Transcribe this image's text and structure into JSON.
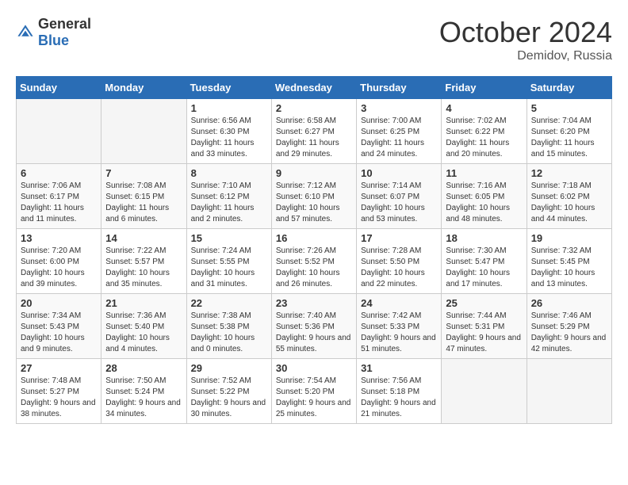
{
  "header": {
    "logo_general": "General",
    "logo_blue": "Blue",
    "month": "October 2024",
    "location": "Demidov, Russia"
  },
  "weekdays": [
    "Sunday",
    "Monday",
    "Tuesday",
    "Wednesday",
    "Thursday",
    "Friday",
    "Saturday"
  ],
  "weeks": [
    [
      {
        "day": "",
        "sunrise": "",
        "sunset": "",
        "daylight": ""
      },
      {
        "day": "",
        "sunrise": "",
        "sunset": "",
        "daylight": ""
      },
      {
        "day": "1",
        "sunrise": "Sunrise: 6:56 AM",
        "sunset": "Sunset: 6:30 PM",
        "daylight": "Daylight: 11 hours and 33 minutes."
      },
      {
        "day": "2",
        "sunrise": "Sunrise: 6:58 AM",
        "sunset": "Sunset: 6:27 PM",
        "daylight": "Daylight: 11 hours and 29 minutes."
      },
      {
        "day": "3",
        "sunrise": "Sunrise: 7:00 AM",
        "sunset": "Sunset: 6:25 PM",
        "daylight": "Daylight: 11 hours and 24 minutes."
      },
      {
        "day": "4",
        "sunrise": "Sunrise: 7:02 AM",
        "sunset": "Sunset: 6:22 PM",
        "daylight": "Daylight: 11 hours and 20 minutes."
      },
      {
        "day": "5",
        "sunrise": "Sunrise: 7:04 AM",
        "sunset": "Sunset: 6:20 PM",
        "daylight": "Daylight: 11 hours and 15 minutes."
      }
    ],
    [
      {
        "day": "6",
        "sunrise": "Sunrise: 7:06 AM",
        "sunset": "Sunset: 6:17 PM",
        "daylight": "Daylight: 11 hours and 11 minutes."
      },
      {
        "day": "7",
        "sunrise": "Sunrise: 7:08 AM",
        "sunset": "Sunset: 6:15 PM",
        "daylight": "Daylight: 11 hours and 6 minutes."
      },
      {
        "day": "8",
        "sunrise": "Sunrise: 7:10 AM",
        "sunset": "Sunset: 6:12 PM",
        "daylight": "Daylight: 11 hours and 2 minutes."
      },
      {
        "day": "9",
        "sunrise": "Sunrise: 7:12 AM",
        "sunset": "Sunset: 6:10 PM",
        "daylight": "Daylight: 10 hours and 57 minutes."
      },
      {
        "day": "10",
        "sunrise": "Sunrise: 7:14 AM",
        "sunset": "Sunset: 6:07 PM",
        "daylight": "Daylight: 10 hours and 53 minutes."
      },
      {
        "day": "11",
        "sunrise": "Sunrise: 7:16 AM",
        "sunset": "Sunset: 6:05 PM",
        "daylight": "Daylight: 10 hours and 48 minutes."
      },
      {
        "day": "12",
        "sunrise": "Sunrise: 7:18 AM",
        "sunset": "Sunset: 6:02 PM",
        "daylight": "Daylight: 10 hours and 44 minutes."
      }
    ],
    [
      {
        "day": "13",
        "sunrise": "Sunrise: 7:20 AM",
        "sunset": "Sunset: 6:00 PM",
        "daylight": "Daylight: 10 hours and 39 minutes."
      },
      {
        "day": "14",
        "sunrise": "Sunrise: 7:22 AM",
        "sunset": "Sunset: 5:57 PM",
        "daylight": "Daylight: 10 hours and 35 minutes."
      },
      {
        "day": "15",
        "sunrise": "Sunrise: 7:24 AM",
        "sunset": "Sunset: 5:55 PM",
        "daylight": "Daylight: 10 hours and 31 minutes."
      },
      {
        "day": "16",
        "sunrise": "Sunrise: 7:26 AM",
        "sunset": "Sunset: 5:52 PM",
        "daylight": "Daylight: 10 hours and 26 minutes."
      },
      {
        "day": "17",
        "sunrise": "Sunrise: 7:28 AM",
        "sunset": "Sunset: 5:50 PM",
        "daylight": "Daylight: 10 hours and 22 minutes."
      },
      {
        "day": "18",
        "sunrise": "Sunrise: 7:30 AM",
        "sunset": "Sunset: 5:47 PM",
        "daylight": "Daylight: 10 hours and 17 minutes."
      },
      {
        "day": "19",
        "sunrise": "Sunrise: 7:32 AM",
        "sunset": "Sunset: 5:45 PM",
        "daylight": "Daylight: 10 hours and 13 minutes."
      }
    ],
    [
      {
        "day": "20",
        "sunrise": "Sunrise: 7:34 AM",
        "sunset": "Sunset: 5:43 PM",
        "daylight": "Daylight: 10 hours and 9 minutes."
      },
      {
        "day": "21",
        "sunrise": "Sunrise: 7:36 AM",
        "sunset": "Sunset: 5:40 PM",
        "daylight": "Daylight: 10 hours and 4 minutes."
      },
      {
        "day": "22",
        "sunrise": "Sunrise: 7:38 AM",
        "sunset": "Sunset: 5:38 PM",
        "daylight": "Daylight: 10 hours and 0 minutes."
      },
      {
        "day": "23",
        "sunrise": "Sunrise: 7:40 AM",
        "sunset": "Sunset: 5:36 PM",
        "daylight": "Daylight: 9 hours and 55 minutes."
      },
      {
        "day": "24",
        "sunrise": "Sunrise: 7:42 AM",
        "sunset": "Sunset: 5:33 PM",
        "daylight": "Daylight: 9 hours and 51 minutes."
      },
      {
        "day": "25",
        "sunrise": "Sunrise: 7:44 AM",
        "sunset": "Sunset: 5:31 PM",
        "daylight": "Daylight: 9 hours and 47 minutes."
      },
      {
        "day": "26",
        "sunrise": "Sunrise: 7:46 AM",
        "sunset": "Sunset: 5:29 PM",
        "daylight": "Daylight: 9 hours and 42 minutes."
      }
    ],
    [
      {
        "day": "27",
        "sunrise": "Sunrise: 7:48 AM",
        "sunset": "Sunset: 5:27 PM",
        "daylight": "Daylight: 9 hours and 38 minutes."
      },
      {
        "day": "28",
        "sunrise": "Sunrise: 7:50 AM",
        "sunset": "Sunset: 5:24 PM",
        "daylight": "Daylight: 9 hours and 34 minutes."
      },
      {
        "day": "29",
        "sunrise": "Sunrise: 7:52 AM",
        "sunset": "Sunset: 5:22 PM",
        "daylight": "Daylight: 9 hours and 30 minutes."
      },
      {
        "day": "30",
        "sunrise": "Sunrise: 7:54 AM",
        "sunset": "Sunset: 5:20 PM",
        "daylight": "Daylight: 9 hours and 25 minutes."
      },
      {
        "day": "31",
        "sunrise": "Sunrise: 7:56 AM",
        "sunset": "Sunset: 5:18 PM",
        "daylight": "Daylight: 9 hours and 21 minutes."
      },
      {
        "day": "",
        "sunrise": "",
        "sunset": "",
        "daylight": ""
      },
      {
        "day": "",
        "sunrise": "",
        "sunset": "",
        "daylight": ""
      }
    ]
  ]
}
